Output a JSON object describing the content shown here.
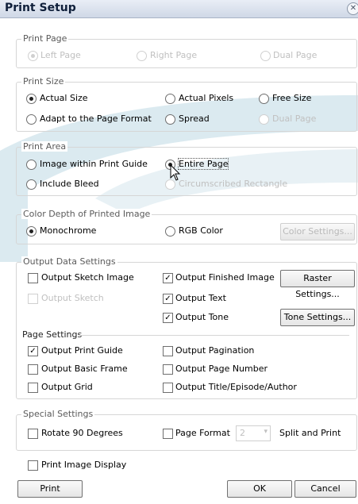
{
  "window": {
    "title": "Print Setup",
    "close_glyph": "✕"
  },
  "print_page": {
    "legend": "Print Page",
    "options": [
      {
        "label": "Left Page",
        "selected": true,
        "enabled": false
      },
      {
        "label": "Right Page",
        "selected": false,
        "enabled": false
      },
      {
        "label": "Dual Page",
        "selected": false,
        "enabled": false
      }
    ]
  },
  "print_size": {
    "legend": "Print Size",
    "options": [
      {
        "label": "Actual Size",
        "selected": true,
        "enabled": true
      },
      {
        "label": "Actual Pixels",
        "selected": false,
        "enabled": true
      },
      {
        "label": "Free Size",
        "selected": false,
        "enabled": true
      },
      {
        "label": "Adapt to the Page Format",
        "selected": false,
        "enabled": true
      },
      {
        "label": "Spread",
        "selected": false,
        "enabled": true
      },
      {
        "label": "Dual Page",
        "selected": false,
        "enabled": false
      }
    ]
  },
  "print_area": {
    "legend": "Print Area",
    "options": [
      {
        "label": "Image within Print Guide",
        "selected": false,
        "enabled": true
      },
      {
        "label": "Entire Page",
        "selected": true,
        "enabled": true
      },
      {
        "label": "Include Bleed",
        "selected": false,
        "enabled": true
      },
      {
        "label": "Circumscribed Rectangle",
        "selected": false,
        "enabled": false
      }
    ]
  },
  "color_depth": {
    "legend": "Color Depth of Printed Image",
    "options": [
      {
        "label": "Monochrome",
        "selected": true,
        "enabled": true
      },
      {
        "label": "RGB Color",
        "selected": false,
        "enabled": true
      }
    ],
    "settings_button": "Color Settings..."
  },
  "output_data": {
    "legend": "Output Data Settings",
    "checks": [
      {
        "label": "Output Sketch Image",
        "checked": false,
        "enabled": true
      },
      {
        "label": "Output Finished Image",
        "checked": true,
        "enabled": true
      },
      {
        "label": "Output Sketch",
        "checked": false,
        "enabled": false
      },
      {
        "label": "Output Text",
        "checked": true,
        "enabled": true
      },
      {
        "label": "Output Tone",
        "checked": true,
        "enabled": true
      }
    ],
    "raster_button": "Raster Settings...",
    "tone_button": "Tone Settings..."
  },
  "page_settings": {
    "heading": "Page Settings",
    "checks": [
      {
        "label": "Output Print Guide",
        "checked": true,
        "enabled": true
      },
      {
        "label": "Output Pagination",
        "checked": false,
        "enabled": true
      },
      {
        "label": "Output Basic Frame",
        "checked": false,
        "enabled": true
      },
      {
        "label": "Output Page Number",
        "checked": false,
        "enabled": true
      },
      {
        "label": "Output Grid",
        "checked": false,
        "enabled": true
      },
      {
        "label": "Output Title/Episode/Author",
        "checked": false,
        "enabled": true
      }
    ]
  },
  "special": {
    "legend": "Special Settings",
    "rotate_label": "Rotate 90 Degrees",
    "page_format_label": "Page Format",
    "page_format_value": "2",
    "split_label": "Split and Print"
  },
  "print_image_display": "Print Image Display",
  "buttons": {
    "print": "Print",
    "ok": "OK",
    "cancel": "Cancel"
  },
  "colors": {
    "title_text": "#0f1f3a",
    "watermark": "#7fb4c8",
    "disabled": "#c0c0c0"
  },
  "icons": {
    "check_glyph": "✓",
    "dropdown_glyph": "▾"
  }
}
